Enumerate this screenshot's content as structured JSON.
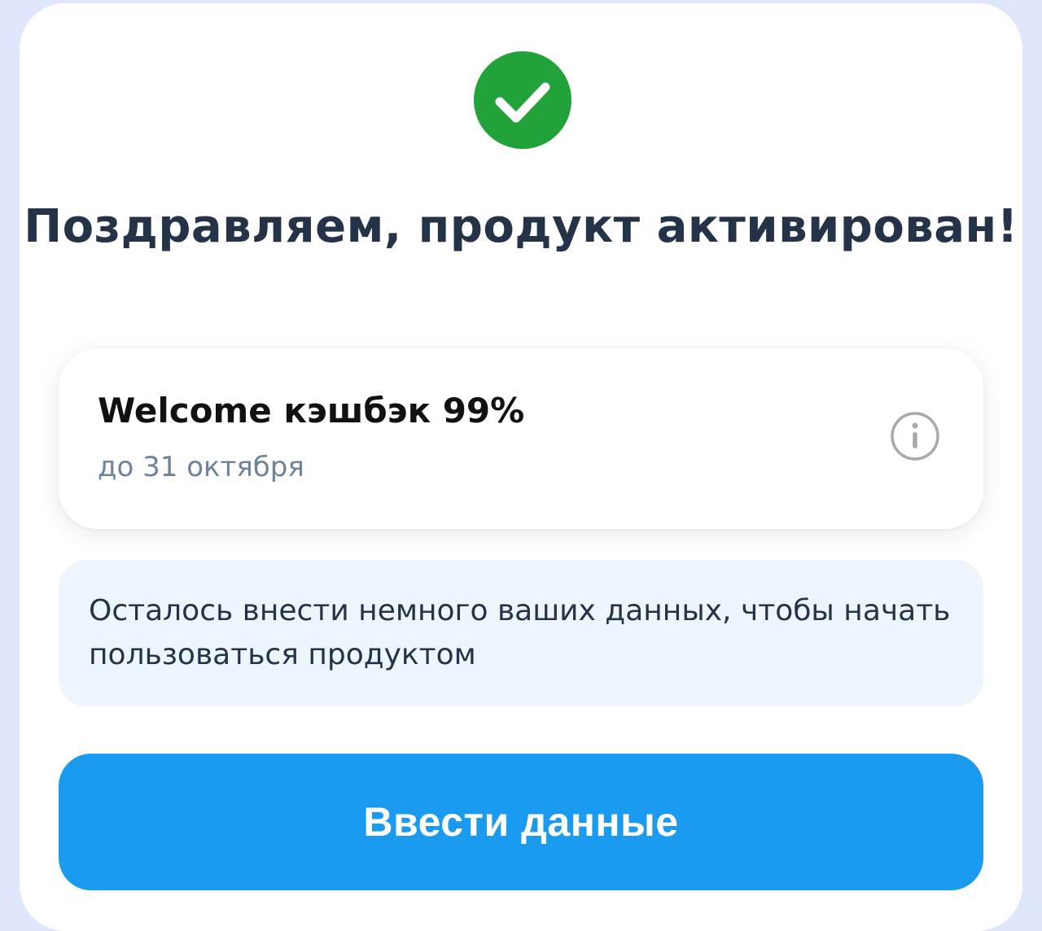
{
  "header": {
    "title": "Поздравляем, продукт активирован!",
    "success_icon": "check-circle-icon"
  },
  "promo": {
    "title": "Welcome кэшбэк 99%",
    "expiry": "до 31 октября",
    "info_icon": "info-icon"
  },
  "notice": {
    "text": "Осталось внести немного ваших данных, чтобы начать пользоваться продуктом"
  },
  "cta": {
    "label": "Ввести данные"
  },
  "colors": {
    "success": "#22a33a",
    "primary": "#1a9bf0",
    "title_text": "#243347",
    "muted_text": "#6d8399",
    "notice_bg": "#edf6fd",
    "page_bg": "#dde6fb"
  }
}
